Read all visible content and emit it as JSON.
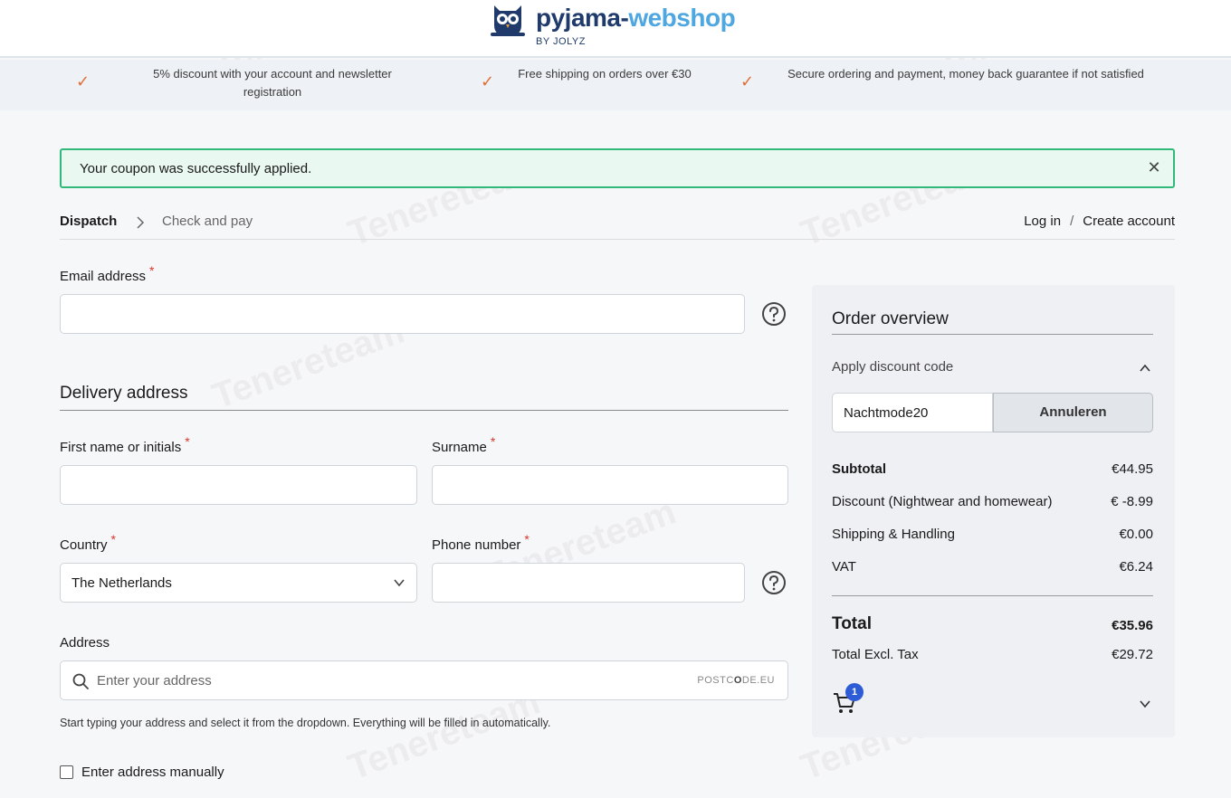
{
  "brand": {
    "name_main": "pyjama-",
    "name_accent": "webshop",
    "sub": "BY JOLYZ"
  },
  "usps": [
    {
      "text": "5% discount with your account and newsletter registration"
    },
    {
      "text": "Free shipping on orders over €30"
    },
    {
      "text": "Secure ordering and payment, money back guarantee if not satisfied"
    }
  ],
  "alert": {
    "message": "Your coupon was successfully applied.",
    "close_icon": "close-icon"
  },
  "steps": {
    "active": "Dispatch",
    "next": "Check and pay"
  },
  "account": {
    "login": "Log in",
    "separator": "/",
    "create": "Create account"
  },
  "form": {
    "email_label": "Email address",
    "email_value": "",
    "delivery_title": "Delivery address",
    "first_name_label": "First name or initials",
    "first_name_value": "",
    "surname_label": "Surname",
    "surname_value": "",
    "country_label": "Country",
    "country_value": "The Netherlands",
    "phone_label": "Phone number",
    "phone_value": "",
    "address_label": "Address",
    "address_placeholder": "Enter your address",
    "postcode_brand_a": "POSTC",
    "postcode_brand_b": "O",
    "postcode_brand_c": "DE.EU",
    "hint": "Start typing your address and select it from the dropdown. Everything will be filled in automatically.",
    "manual_label": "Enter address manually",
    "required_mark": "*"
  },
  "order": {
    "title": "Order overview",
    "discount_head": "Apply discount code",
    "discount_code": "Nachtmode20",
    "cancel_label": "Annuleren",
    "subtotal_label": "Subtotal",
    "subtotal_value": "€44.95",
    "discount_label": "Discount (Nightwear and homewear)",
    "discount_value": "€ -8.99",
    "shipping_label": "Shipping & Handling",
    "shipping_value": "€0.00",
    "vat_label": "VAT",
    "vat_value": "€6.24",
    "total_label": "Total",
    "total_value": "€35.96",
    "excl_label": "Total Excl. Tax",
    "excl_value": "€29.72",
    "cart_count": "1"
  },
  "watermark": "Tenereteam",
  "colors": {
    "success_border": "#31b97a",
    "success_bg": "#e9f8f0",
    "check_orange": "#e0703a",
    "brand_navy": "#1f3a6b",
    "brand_blue": "#4ea7e0",
    "badge_blue": "#2e5bd6",
    "required_red": "#d9382f"
  }
}
